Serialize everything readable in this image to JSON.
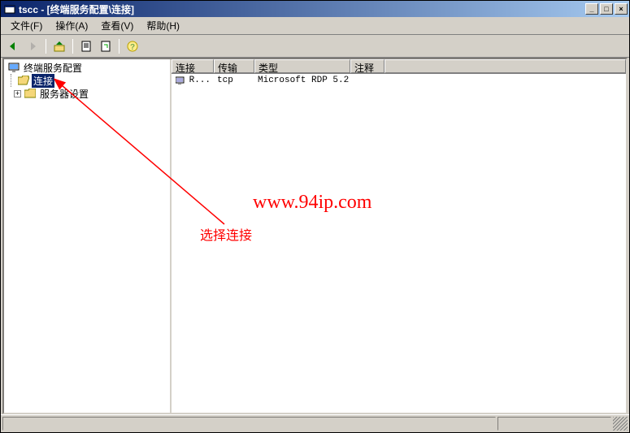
{
  "title": "tscc - [终端服务配置\\连接]",
  "menu": {
    "file": "文件(F)",
    "action": "操作(A)",
    "view": "查看(V)",
    "help": "帮助(H)"
  },
  "tree": {
    "root": "终端服务配置",
    "connections": "连接",
    "server_settings": "服务器设置"
  },
  "columns": {
    "connection": "连接",
    "transport": "传输",
    "type": "类型",
    "comment": "注释"
  },
  "col_widths": {
    "connection": 52,
    "transport": 50,
    "type": 118,
    "comment": 42
  },
  "row": {
    "connection": "R...",
    "transport": "tcp",
    "type": "Microsoft RDP 5.2",
    "comment": ""
  },
  "annotation": {
    "watermark": "www.94ip.com",
    "label": "选择连接"
  },
  "winbtn": {
    "min": "_",
    "max": "□",
    "close": "×"
  },
  "tree_toggle": {
    "plus": "+",
    "minus": ""
  }
}
